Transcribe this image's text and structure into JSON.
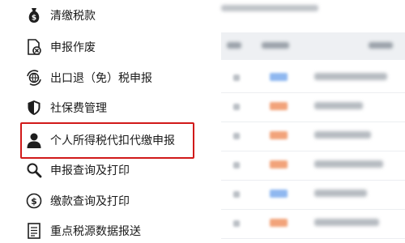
{
  "menu": {
    "items": [
      {
        "label": "清缴税款",
        "icon": "money-bag-icon"
      },
      {
        "label": "申报作废",
        "icon": "document-cancel-icon"
      },
      {
        "label": "出口退（免）税申报",
        "icon": "globe-refresh-icon"
      },
      {
        "label": "社保费管理",
        "icon": "shield-icon"
      },
      {
        "label": "个人所得税代扣代缴申报",
        "icon": "person-icon"
      },
      {
        "label": "申报查询及打印",
        "icon": "search-icon"
      },
      {
        "label": "缴款查询及打印",
        "icon": "dollar-circle-icon"
      },
      {
        "label": "重点税源数据报送",
        "icon": "report-list-icon"
      }
    ],
    "selected_index": 4
  },
  "colors": {
    "highlight_border": "#d11a1a",
    "badge_blue": "#8fb8f0",
    "badge_orange": "#f2a37a"
  },
  "content": {
    "rows": [
      {
        "badge": "blue"
      },
      {
        "badge": "orange"
      },
      {
        "badge": "orange"
      },
      {
        "badge": "orange"
      },
      {
        "badge": "blue"
      },
      {
        "badge": "orange"
      }
    ]
  }
}
